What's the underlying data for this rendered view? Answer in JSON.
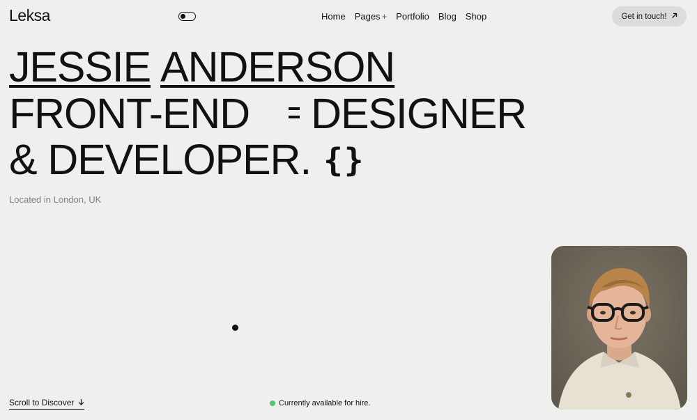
{
  "brand": {
    "logo": "Leksa"
  },
  "nav": {
    "items": [
      {
        "label": "Home"
      },
      {
        "label": "Pages",
        "suffix": "+"
      },
      {
        "label": "Portfolio"
      },
      {
        "label": "Blog"
      },
      {
        "label": "Shop"
      }
    ]
  },
  "header": {
    "cta_label": "Get in touch!",
    "cta_icon": "arrow-up-right-icon"
  },
  "hero": {
    "name_first": "JESSIE",
    "name_last": "ANDERSON",
    "line2_left": "FRONT-END",
    "line2_right": "DESIGNER",
    "line3": "& DEVELOPER.",
    "braces": "{}",
    "location": "Located in London, UK"
  },
  "footer": {
    "scroll_label": "Scroll to Discover",
    "scroll_icon": "arrow-down-icon",
    "status_text": "Currently available for hire.",
    "status_color": "#4cc96a"
  },
  "colors": {
    "background": "#efefef",
    "text": "#111111",
    "muted": "#808080",
    "cta_bg": "#dcdcdc"
  }
}
